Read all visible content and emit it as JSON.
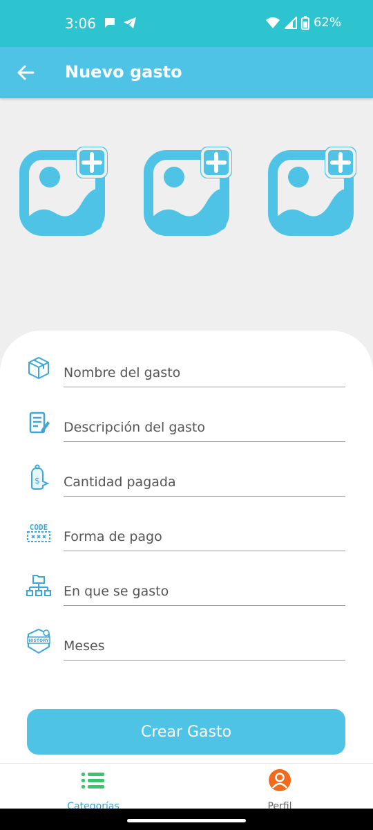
{
  "status_bar": {
    "time": "3:06",
    "battery": "62%"
  },
  "app_bar": {
    "title": "Nuevo gasto"
  },
  "image_slots": [
    {
      "icon": "add-photo-icon"
    },
    {
      "icon": "add-photo-icon"
    },
    {
      "icon": "add-photo-icon"
    }
  ],
  "form": {
    "fields": [
      {
        "placeholder": "Nombre del gasto",
        "icon": "box-icon"
      },
      {
        "placeholder": "Descripción del gasto",
        "icon": "edit-document-icon"
      },
      {
        "placeholder": "Cantidad pagada",
        "icon": "price-tag-icon"
      },
      {
        "placeholder": "Forma de pago",
        "icon": "code-icon"
      },
      {
        "placeholder": "En que se gasto",
        "icon": "hierarchy-icon"
      },
      {
        "placeholder": "Meses",
        "icon": "history-badge-icon"
      }
    ],
    "icon_labels": {
      "code": "CODE",
      "history": "HISTORY"
    },
    "submit_label": "Crear Gasto"
  },
  "bottom_nav": {
    "items": [
      {
        "label": "Categorías",
        "icon": "list-icon",
        "active": true
      },
      {
        "label": "Perfil",
        "icon": "user-avatar-icon",
        "active": false
      }
    ]
  },
  "colors": {
    "status_bar": "#2ec4cf",
    "accent": "#4fc3e6",
    "active_nav": "#2f9fd8",
    "inactive_nav": "#666666",
    "nav_icon_green": "#3bc46d",
    "profile_orange": "#f26b1d"
  }
}
